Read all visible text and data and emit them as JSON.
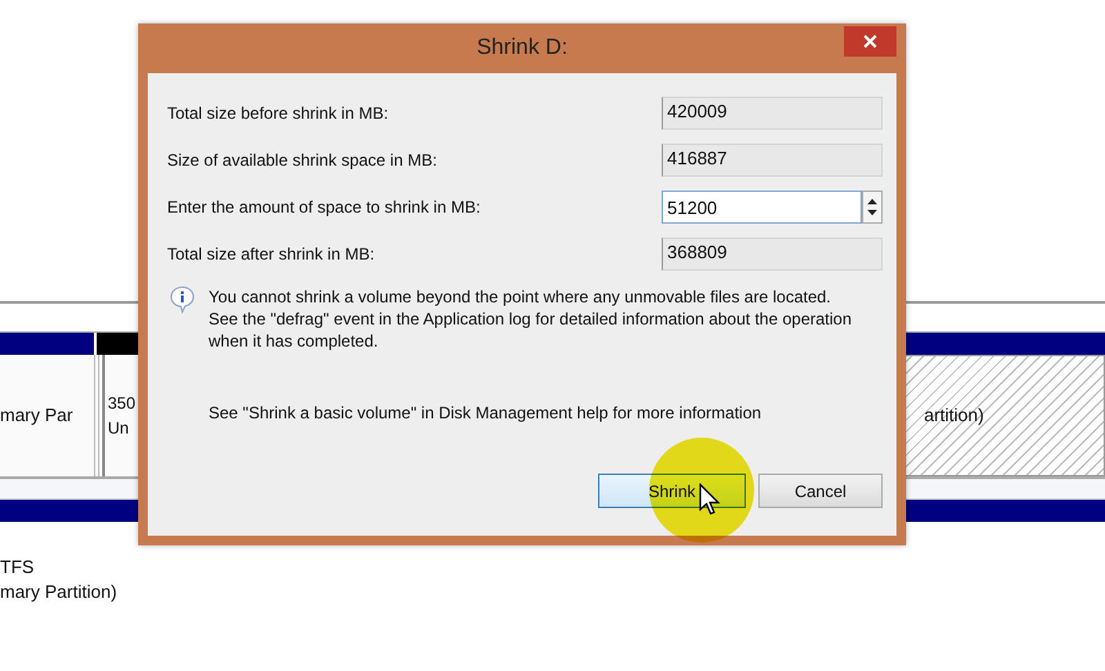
{
  "disk_map": {
    "disk_1": {
      "header_segments": [
        {
          "kind": "primary"
        },
        {
          "kind": "unallocated"
        },
        {
          "kind": "primary"
        }
      ],
      "partitions": [
        {
          "kind": "primary",
          "lines": [
            "mary Par"
          ]
        },
        {
          "kind": "unallocated",
          "lines": [
            "350",
            "Un"
          ]
        },
        {
          "kind": "selected",
          "lines": [
            "artition)"
          ]
        }
      ]
    },
    "disk_2": {
      "lines": [
        "TFS",
        "mary Partition)"
      ]
    }
  },
  "dialog": {
    "title": "Shrink D:",
    "fields": [
      {
        "label": "Total size before shrink in MB:",
        "value": "420009",
        "kind": "readonly"
      },
      {
        "label": "Size of available shrink space in MB:",
        "value": "416887",
        "kind": "readonly"
      },
      {
        "label": "Enter the amount of space to shrink in MB:",
        "value": "51200",
        "kind": "spin"
      },
      {
        "label": "Total size after shrink in MB:",
        "value": "368809",
        "kind": "readonly"
      }
    ],
    "info": "You cannot shrink a volume beyond the point where any unmovable files are located. See the \"defrag\" event in the Application log for detailed information about the operation when it has completed.",
    "help": "See \"Shrink a basic volume\" in Disk Management help for more information",
    "buttons": [
      {
        "label": "Shrink",
        "default": true
      },
      {
        "label": "Cancel",
        "default": false
      }
    ]
  }
}
